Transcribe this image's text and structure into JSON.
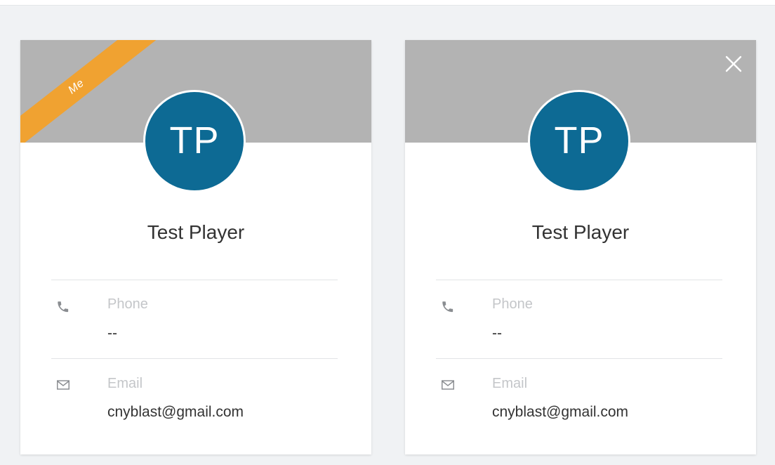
{
  "colors": {
    "page_background": "#f0f2f4",
    "card_header": "#b3b3b3",
    "ribbon": "#f0a231",
    "avatar": "#0d6a94",
    "label": "#c4c6c9",
    "text": "#333333"
  },
  "cards": [
    {
      "ribbon": "Me",
      "avatar_initials": "TP",
      "name": "Test Player",
      "phone": {
        "icon": "phone-icon",
        "label": "Phone",
        "value": "--"
      },
      "email": {
        "icon": "mail-icon",
        "label": "Email",
        "value": "cnyblast@gmail.com"
      }
    },
    {
      "close_icon": "close-icon",
      "avatar_initials": "TP",
      "name": "Test Player",
      "phone": {
        "icon": "phone-icon",
        "label": "Phone",
        "value": "--"
      },
      "email": {
        "icon": "mail-icon",
        "label": "Email",
        "value": "cnyblast@gmail.com"
      }
    }
  ]
}
